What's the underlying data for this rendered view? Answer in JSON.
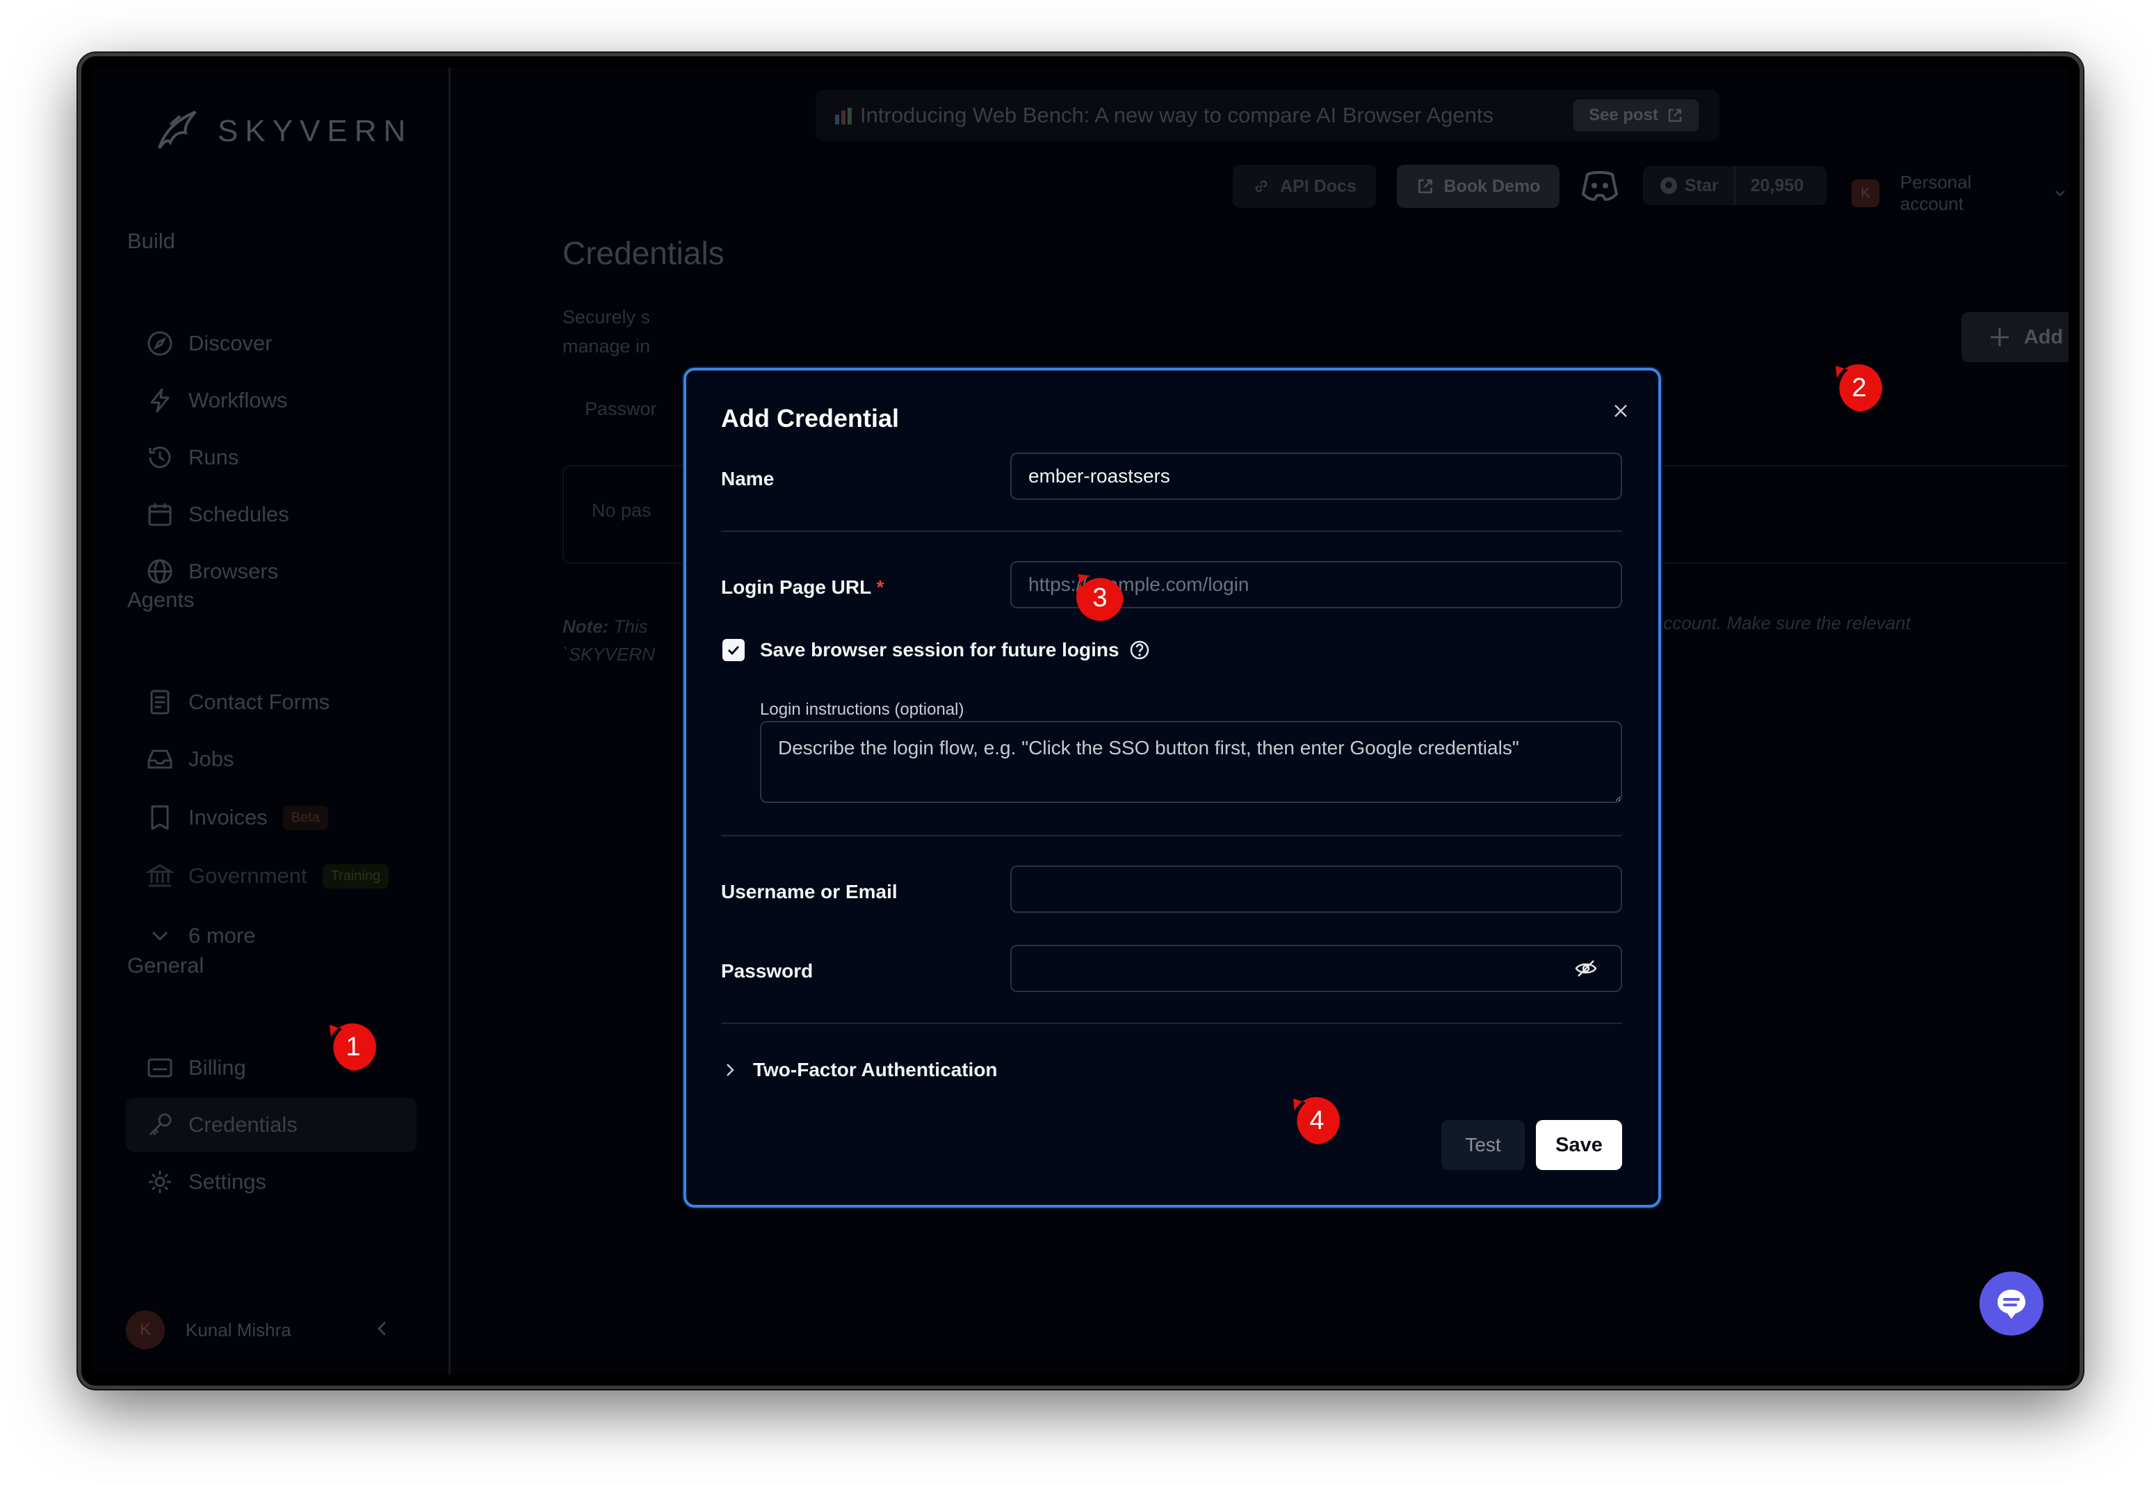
{
  "app": {
    "logo_text": "SKYVERN"
  },
  "sidebar": {
    "sections": {
      "build": "Build",
      "agents": "Agents",
      "general": "General"
    },
    "build_items": [
      {
        "label": "Discover",
        "icon": "compass-icon"
      },
      {
        "label": "Workflows",
        "icon": "lightning-icon"
      },
      {
        "label": "Runs",
        "icon": "history-icon"
      },
      {
        "label": "Schedules",
        "icon": "calendar-icon"
      },
      {
        "label": "Browsers",
        "icon": "globe-icon"
      }
    ],
    "agent_items": [
      {
        "label": "Contact Forms",
        "icon": "form-icon"
      },
      {
        "label": "Jobs",
        "icon": "inbox-icon"
      },
      {
        "label": "Invoices",
        "icon": "receipt-icon",
        "tag": "Beta"
      },
      {
        "label": "Government",
        "icon": "bank-icon",
        "tag": "Training"
      }
    ],
    "more_label": "6 more",
    "general_items": [
      {
        "label": "Billing",
        "icon": "billing-icon"
      },
      {
        "label": "Credentials",
        "icon": "key-icon"
      },
      {
        "label": "Settings",
        "icon": "gear-icon"
      }
    ],
    "user": {
      "initial": "K",
      "name": "Kunal Mishra"
    }
  },
  "header": {
    "banner_text": "Introducing Web Bench: A new way to compare AI Browser Agents",
    "see_post": "See post",
    "api_docs": "API Docs",
    "book_demo": "Book Demo",
    "star_label": "Star",
    "star_count": "20,950",
    "account_initial": "K",
    "account_label": "Personal account"
  },
  "page": {
    "title": "Credentials",
    "desc_line1": "Securely s",
    "desc_line2": "manage in",
    "add_label": "Add",
    "tab_passwords": "Passwor",
    "empty_text": "No pas",
    "note_bold": "Note:",
    "note_line1": " This",
    "note_line2": "`SKYVERN",
    "note_right": "Bitwarden account. Make sure the relevant"
  },
  "modal": {
    "title": "Add Credential",
    "name_label": "Name",
    "name_value": "ember-roastsers",
    "url_label": "Login Page URL",
    "url_required": "*",
    "url_placeholder": "https://example.com/login",
    "save_session_label": "Save browser session for future logins",
    "save_session_checked": true,
    "instructions_label": "Login instructions (optional)",
    "instructions_placeholder": "Describe the login flow, e.g. \"Click the SSO button first, then enter Google credentials\"",
    "username_label": "Username or Email",
    "username_value": "",
    "password_label": "Password",
    "password_value": "",
    "tfa_label": "Two-Factor Authentication",
    "test_label": "Test",
    "save_label": "Save"
  },
  "markers": [
    "1",
    "2",
    "3",
    "4"
  ],
  "colors": {
    "accent": "#3f82e0",
    "marker": "#e8100c",
    "chat": "#5b57e6"
  }
}
